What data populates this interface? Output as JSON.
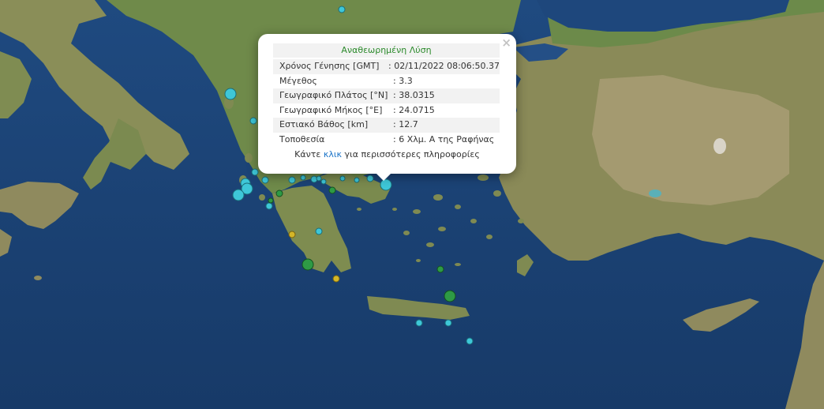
{
  "popup": {
    "title": "Αναθεωρημένη Λύση",
    "close": "×",
    "rows": [
      {
        "label": "Χρόνος Γένησης [GMT]",
        "value": ": 02/11/2022 08:06:50.37"
      },
      {
        "label": "Μέγεθος",
        "value": ": 3.3"
      },
      {
        "label": "Γεωγραφικό Πλάτος [°N]",
        "value": ": 38.0315"
      },
      {
        "label": "Γεωγραφικό Μήκος [°E]",
        "value": ": 24.0715"
      },
      {
        "label": "Εστιακό Βάθος [km]",
        "value": ": 12.7"
      },
      {
        "label": "Τοποθεσία",
        "value": ": 6 Χλμ. Α της Ραφήνας"
      }
    ],
    "more_prefix": "Κάντε ",
    "more_link": "κλικ",
    "more_suffix": " για περισσότερες πληροφορίες"
  },
  "colors": {
    "sea_deep": "#1b3f72",
    "sea_shallow": "#2a5a93",
    "land": "#7c8a52",
    "land_dry": "#a69870",
    "marker_cyan": "#3ec7d8",
    "marker_green": "#2e9a45",
    "marker_yellow": "#d4b628"
  },
  "markers": [
    {
      "type": "cyan",
      "size": "large"
    },
    {
      "type": "cyan",
      "size": "medium"
    },
    {
      "type": "cyan",
      "size": "medium"
    },
    {
      "type": "cyan",
      "size": "large"
    },
    {
      "type": "cyan",
      "size": "small"
    },
    {
      "type": "green",
      "size": "large"
    },
    {
      "type": "green",
      "size": "large"
    },
    {
      "type": "yellow",
      "size": "small"
    },
    {
      "type": "yellow",
      "size": "small"
    }
  ]
}
